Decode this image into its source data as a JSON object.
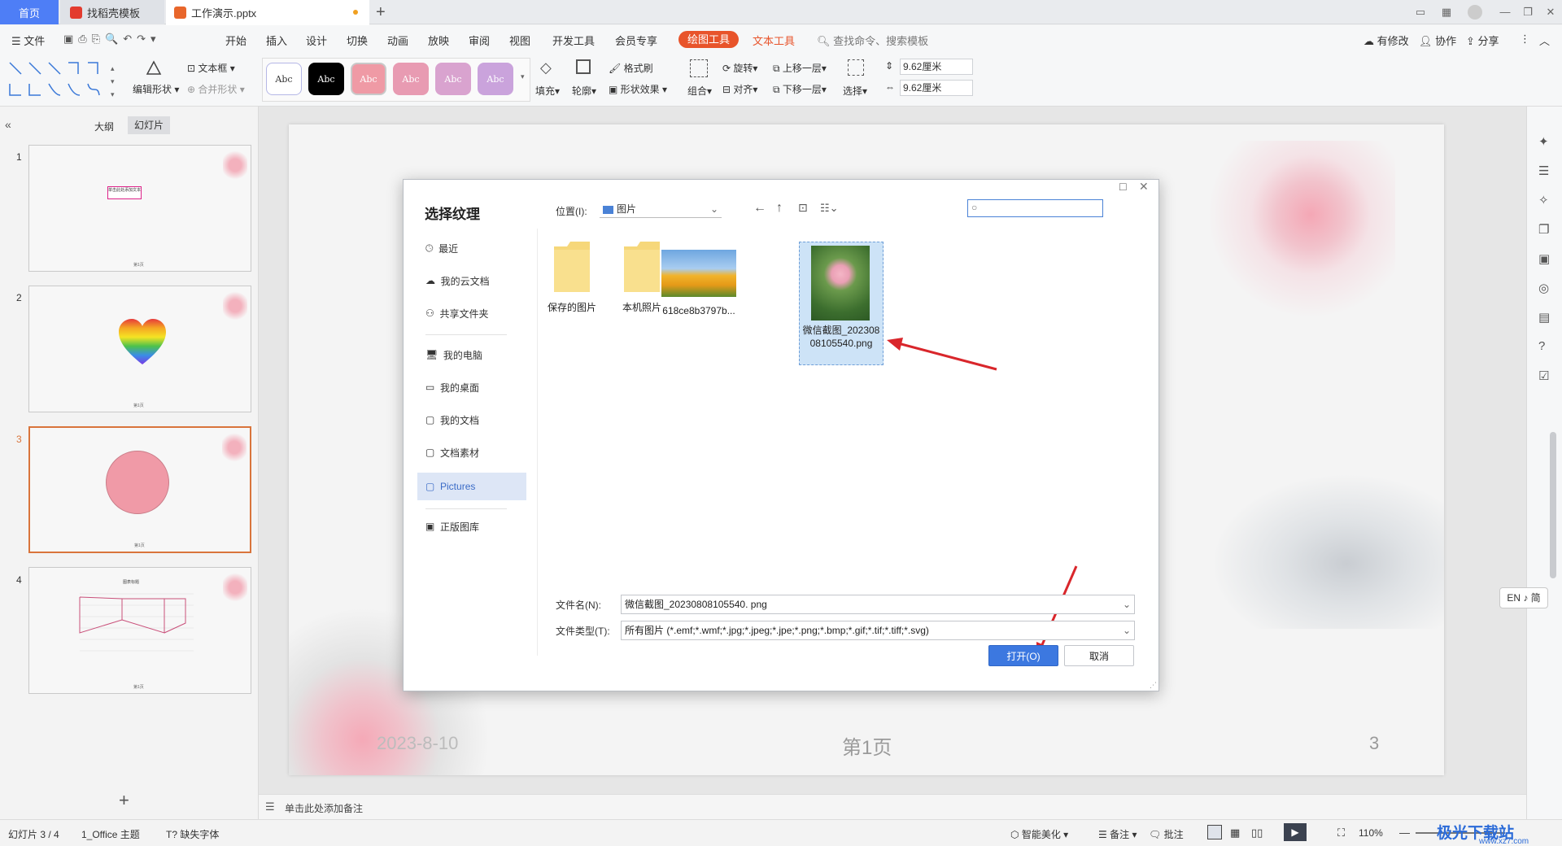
{
  "tabs": {
    "home": "首页",
    "templates": "找稻壳模板",
    "doc": "工作演示.pptx"
  },
  "menu": {
    "file": "文件",
    "items": [
      "开始",
      "插入",
      "设计",
      "切换",
      "动画",
      "放映",
      "审阅",
      "视图",
      "开发工具",
      "会员专享"
    ],
    "drawing_tools": "绘图工具",
    "text_tools": "文本工具",
    "search": "查找命令、搜索模板",
    "changes": "有修改",
    "collab": "协作",
    "share": "分享"
  },
  "toolbar": {
    "edit_shape": "编辑形状",
    "textbox": "文本框",
    "merge_shape": "合并形状",
    "style_label": "Abc",
    "fill": "填充",
    "outline": "轮廓",
    "format_brush": "格式刷",
    "shape_effect": "形状效果",
    "group": "组合",
    "rotate": "旋转",
    "align": "对齐",
    "bring_forward": "上移一层",
    "send_backward": "下移一层",
    "select": "选择",
    "height": "9.62厘米",
    "width": "9.62厘米"
  },
  "leftpanel": {
    "outline_tab": "大纲",
    "slides_tab": "幻灯片",
    "slides": [
      {
        "num": "1"
      },
      {
        "num": "2"
      },
      {
        "num": "3"
      },
      {
        "num": "4"
      }
    ],
    "thumb_footer": "第1页",
    "thumb1_text": "单击此处添加文本",
    "thumb4_title": "图表标题"
  },
  "slide": {
    "date": "2023-8-10",
    "footer": "第1页",
    "page": "3"
  },
  "notes": {
    "placeholder": "单击此处添加备注"
  },
  "status": {
    "slide_count": "幻灯片 3 / 4",
    "theme": "1_Office 主题",
    "missing_font": "缺失字体",
    "beautify": "智能美化",
    "notes": "备注",
    "comment": "批注",
    "zoom": "110%",
    "ime": "EN ♪ 简",
    "watermark": "极光下载站",
    "watermark_url": "www.xz7.com"
  },
  "dialog": {
    "title": "选择纹理",
    "location_label": "位置(I):",
    "location_value": "图片",
    "nav": [
      "最近",
      "我的云文档",
      "共享文件夹",
      "我的电脑",
      "我的桌面",
      "我的文档",
      "文档素材",
      "Pictures",
      "正版图库"
    ],
    "files": [
      "保存的图片",
      "本机照片",
      "618ce8b3797b...",
      "微信截图_20230808105540.png"
    ],
    "filename_label": "文件名(N):",
    "filename_value": "微信截图_20230808105540. png",
    "filetype_label": "文件类型(T):",
    "filetype_value": "所有图片 (*.emf;*.wmf;*.jpg;*.jpeg;*.jpe;*.png;*.bmp;*.gif;*.tif;*.tiff;*.svg)",
    "open": "打开(O)",
    "cancel": "取消"
  },
  "colors": {
    "accent": "#4e7ef6",
    "drawing_pill": "#e8542b",
    "selected_border": "#d9743b",
    "arrow": "#d9262b",
    "circle": "#f09aa7"
  }
}
